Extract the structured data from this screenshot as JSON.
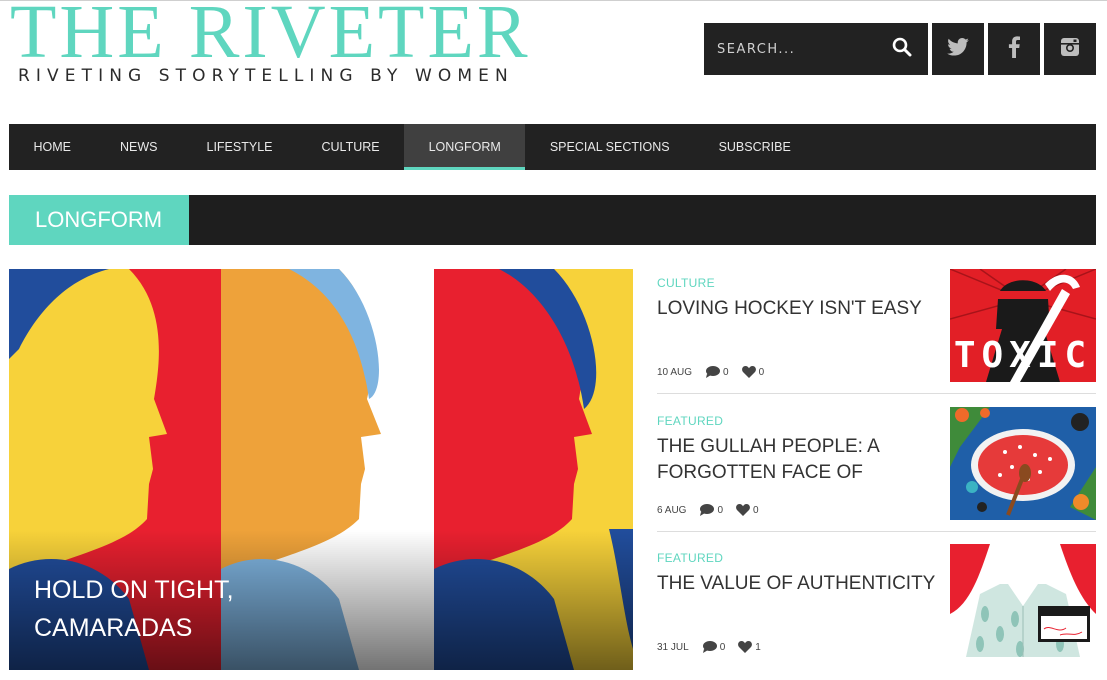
{
  "header": {
    "logo_title": "THE RIVETER",
    "tagline": "RIVETING STORYTELLING BY WOMEN",
    "search_placeholder": "SEARCH..."
  },
  "nav": {
    "items": [
      {
        "label": "HOME"
      },
      {
        "label": "NEWS"
      },
      {
        "label": "LIFESTYLE"
      },
      {
        "label": "CULTURE"
      },
      {
        "label": "LONGFORM",
        "active": true
      },
      {
        "label": "SPECIAL SECTIONS"
      },
      {
        "label": "SUBSCRIBE"
      }
    ]
  },
  "section": {
    "label": "LONGFORM"
  },
  "feature": {
    "title": "HOLD ON TIGHT, CAMARADAS"
  },
  "posts": [
    {
      "category": "CULTURE",
      "title": "LOVING HOCKEY ISN'T EASY",
      "date": "10 AUG",
      "comments": "0",
      "likes": "0",
      "thumb_text": "TOXIC"
    },
    {
      "category": "FEATURED",
      "title": "THE GULLAH PEOPLE: A FORGOTTEN FACE OF",
      "date": "6 AUG",
      "comments": "0",
      "likes": "0"
    },
    {
      "category": "FEATURED",
      "title": "THE VALUE OF AUTHENTICITY",
      "date": "31 JUL",
      "comments": "0",
      "likes": "1"
    }
  ],
  "colors": {
    "accent": "#5fd6bf",
    "dark": "#222222"
  },
  "icons": [
    "search-icon",
    "twitter-icon",
    "facebook-icon",
    "instagram-icon",
    "comment-icon",
    "heart-icon"
  ]
}
